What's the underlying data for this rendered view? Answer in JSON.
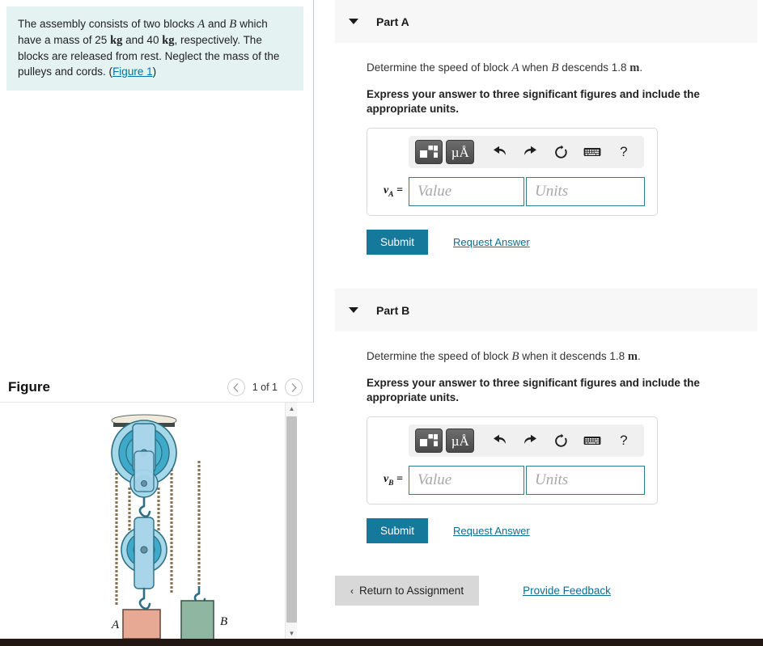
{
  "problem": {
    "text_1": "The assembly consists of two blocks ",
    "var_a": "A",
    "text_2": " and ",
    "var_b": "B",
    "text_3": " which have a mass of 25 ",
    "unit_kg_1": "kg",
    "text_4": " and 40 ",
    "unit_kg_2": "kg",
    "text_5": ", respectively. The blocks are released from rest. Neglect the mass of the pulleys and cords. (",
    "figure_link": "Figure 1",
    "text_6": ")"
  },
  "figure": {
    "title": "Figure",
    "counter": "1 of 1",
    "prev_icon": "chevron-left-icon",
    "next_icon": "chevron-right-icon",
    "block_a_label": "A",
    "block_b_label": "B",
    "colors": {
      "block_a": "#e8a994",
      "block_b": "#8fb6a1",
      "pulley_outer": "#9fd9e8",
      "pulley_inner": "#3aa8c4",
      "bracket": "#9ecfe4",
      "ceiling": "#eeeadb",
      "rope": "#8a7355"
    }
  },
  "parts": [
    {
      "label": "Part A",
      "caret_icon": "caret-down-icon",
      "question_pre": "Determine the speed of block ",
      "question_var1": "A",
      "question_mid": " when ",
      "question_var2": "B",
      "question_post": " descends 1.8 ",
      "question_unit": "m",
      "question_end": ".",
      "instruction": "Express your answer to three significant figures and include the appropriate units.",
      "var_symbol": "v",
      "var_sub": "A",
      "equals": "=",
      "value_placeholder": "Value",
      "units_placeholder": "Units",
      "value_current": "",
      "units_current": "",
      "submit_label": "Submit",
      "request_label": "Request Answer"
    },
    {
      "label": "Part B",
      "caret_icon": "caret-down-icon",
      "question_pre": "Determine the speed of block ",
      "question_var1": "B",
      "question_mid": " when it descends 1.8 ",
      "question_var2": "",
      "question_post": "",
      "question_unit": "m",
      "question_end": ".",
      "instruction": "Express your answer to three significant figures and include the appropriate units.",
      "var_symbol": "v",
      "var_sub": "B",
      "equals": "=",
      "value_placeholder": "Value",
      "units_placeholder": "Units",
      "value_current": "",
      "units_current": "",
      "submit_label": "Submit",
      "request_label": "Request Answer"
    }
  ],
  "toolbar": {
    "template_icon": "math-template-icon",
    "units_icon_label": "µÅ",
    "undo_icon": "undo-icon",
    "redo_icon": "redo-icon",
    "reset_icon": "reset-icon",
    "keyboard_icon": "keyboard-icon",
    "help_icon": "?"
  },
  "footer": {
    "return_label": "Return to Assignment",
    "return_chevron": "‹",
    "feedback_label": "Provide Feedback"
  },
  "colors": {
    "accent_teal": "#15799b",
    "link_blue": "#0a6f95",
    "problem_bg": "#e4f3f2",
    "part_header_bg": "#f7f7f7",
    "input_border": "#2b7d94"
  }
}
